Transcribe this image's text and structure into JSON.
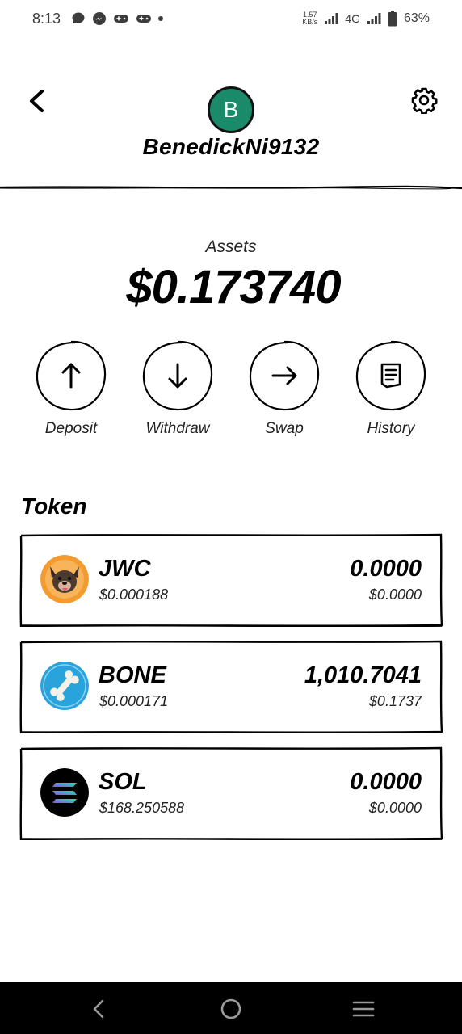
{
  "status_bar": {
    "time": "8:13",
    "net_speed": "1.57",
    "net_unit": "KB/s",
    "network": "4G",
    "battery": "63%"
  },
  "header": {
    "avatar_letter": "B",
    "username": "BenedickNi9132",
    "avatar_color": "#1b8a6b"
  },
  "assets": {
    "label": "Assets",
    "value": "$0.173740"
  },
  "actions": [
    {
      "label": "Deposit",
      "icon": "arrow-up-icon"
    },
    {
      "label": "Withdraw",
      "icon": "arrow-down-icon"
    },
    {
      "label": "Swap",
      "icon": "arrow-right-icon"
    },
    {
      "label": "History",
      "icon": "document-icon"
    }
  ],
  "token_section": {
    "title": "Token"
  },
  "tokens": [
    {
      "symbol": "JWC",
      "price": "$0.000188",
      "balance": "0.0000",
      "value": "$0.0000",
      "icon": "jwc-dog-icon",
      "icon_bg": "#f39b2e"
    },
    {
      "symbol": "BONE",
      "price": "$0.000171",
      "balance": "1,010.7041",
      "value": "$0.1737",
      "icon": "bone-icon",
      "icon_bg": "#29a3dc"
    },
    {
      "symbol": "SOL",
      "price": "$168.250588",
      "balance": "0.0000",
      "value": "$0.0000",
      "icon": "solana-icon",
      "icon_bg": "#000000"
    }
  ]
}
